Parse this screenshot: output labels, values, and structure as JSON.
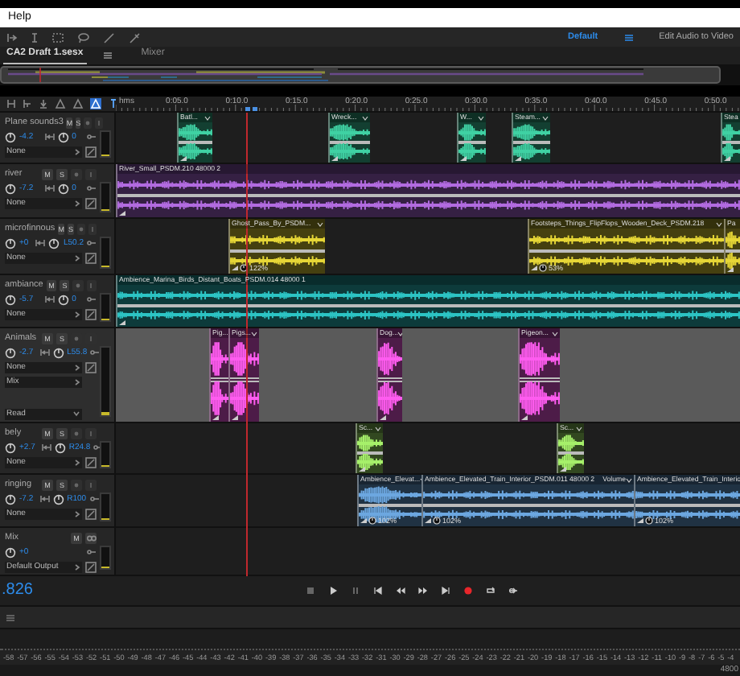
{
  "menu": [
    "Help"
  ],
  "workspaces": [
    {
      "label": "Default",
      "selected": true
    },
    {
      "label": "Edit Audio to Video",
      "selected": false
    }
  ],
  "tabs": [
    {
      "label": "CA2 Draft 1.sesx",
      "selected": true
    },
    {
      "label": "Mixer",
      "selected": false
    }
  ],
  "ruler_tools": [
    {
      "selected": false
    },
    {
      "selected": false
    },
    {
      "selected": true
    },
    {
      "selected": false
    }
  ],
  "ruler": {
    "labels": [
      "hms",
      "0:05.0",
      "0:10.0",
      "0:15.0",
      "0:20.0",
      "0:25.0",
      "0:30.0",
      "0:35.0",
      "0:40.0",
      "0:45.0",
      "0:50.0"
    ]
  },
  "tracks": [
    {
      "name": "Plane sounds3",
      "kind": "audio",
      "selected": false,
      "buttons": [
        "M",
        "S"
      ],
      "volume": "-4.2",
      "pan": "0",
      "level": 0.05,
      "dropdowns": [
        {
          "label": "None",
          "kind": "output"
        }
      ],
      "clips": [
        {
          "label": "Batl...",
          "color": "#3fd1a3"
        },
        {
          "label": "Wreck...",
          "color": "#3fd1a3"
        },
        {
          "label": "W...",
          "color": "#3fd1a3"
        },
        {
          "label": "Steam...",
          "color": "#3fd1a3"
        },
        {
          "label": "Stea",
          "color": "#3fd1a3"
        }
      ]
    },
    {
      "name": "river",
      "kind": "audio",
      "selected": false,
      "buttons": [
        "M",
        "S"
      ],
      "volume": "-7.2",
      "pan": "0",
      "level": 0.05,
      "dropdowns": [
        {
          "label": "None",
          "kind": "output"
        }
      ],
      "clips": [
        {
          "label": "River_Small_PSDM.210 48000 2",
          "color": "#b26be0"
        }
      ]
    },
    {
      "name": "microfinnous",
      "kind": "audio",
      "selected": false,
      "buttons": [
        "M",
        "S"
      ],
      "volume": "+0",
      "pan": "L50.2",
      "level": 0.05,
      "dropdowns": [
        {
          "label": "None",
          "kind": "output"
        }
      ],
      "clips": [
        {
          "label": "Ghost_Pass_By_PSDM...",
          "color": "#e6d636",
          "gain": "122%"
        },
        {
          "label": "Footsteps_Things_FlipFlops_Wooden_Deck_PSDM.218",
          "color": "#e6d636",
          "gain": "53%"
        },
        {
          "label": "Pa",
          "color": "#e6d636"
        }
      ]
    },
    {
      "name": "ambiance",
      "kind": "audio",
      "selected": false,
      "buttons": [
        "M",
        "S"
      ],
      "volume": "-5.7",
      "pan": "0",
      "level": 0.05,
      "dropdowns": [
        {
          "label": "None",
          "kind": "output"
        }
      ],
      "clips": [
        {
          "label": "Ambience_Marina_Birds_Distant_Boats_PSDM.014 48000 1",
          "color": "#2cc4c4"
        }
      ]
    },
    {
      "name": "Animals",
      "kind": "audio",
      "selected": true,
      "buttons": [
        "M",
        "S"
      ],
      "volume": "-2.7",
      "pan": "L55.8",
      "level": 0.05,
      "dropdowns": [
        {
          "label": "None",
          "kind": "output"
        },
        {
          "label": "Mix",
          "kind": "send"
        },
        {
          "label": "Read",
          "kind": "automation"
        }
      ],
      "clips": [
        {
          "label": "Pig...",
          "color": "#ff5cf0"
        },
        {
          "label": "Pigs...",
          "color": "#ff5cf0"
        },
        {
          "label": "Dog...",
          "color": "#ff5cf0"
        },
        {
          "label": "Pigeon...",
          "color": "#ff5cf0"
        }
      ]
    },
    {
      "name": "bely",
      "kind": "audio",
      "selected": false,
      "buttons": [
        "M",
        "S"
      ],
      "volume": "+2.7",
      "pan": "R24.8",
      "level": 0.05,
      "dropdowns": [
        {
          "label": "None",
          "kind": "output"
        }
      ],
      "clips": [
        {
          "label": "Sc...",
          "color": "#a6f06a"
        },
        {
          "label": "Sc...",
          "color": "#a6f06a"
        }
      ]
    },
    {
      "name": "ringing",
      "kind": "audio",
      "selected": false,
      "buttons": [
        "M",
        "S"
      ],
      "volume": "-7.2",
      "pan": "R100",
      "level": 0.05,
      "dropdowns": [
        {
          "label": "None",
          "kind": "output"
        }
      ],
      "clips": [
        {
          "label": "Ambience_Elevat...",
          "color": "#6ca7e0",
          "gain": "102%"
        },
        {
          "label": "Ambience_Elevated_Train_Interior_PSDM.011 48000 2",
          "color": "#6ca7e0",
          "gain": "102%",
          "envelope": "Volume"
        },
        {
          "label": "Ambience_Elevated_Train_Interio",
          "color": "#6ca7e0",
          "gain": "102%"
        }
      ]
    },
    {
      "name": "Mix",
      "kind": "master",
      "selected": false,
      "buttons": [
        "M"
      ],
      "volume": "+0",
      "level": 0.05,
      "dropdowns": [
        {
          "label": "Default Output",
          "kind": "output"
        }
      ]
    }
  ],
  "time": ".826",
  "meter_scale": [
    "-58",
    "-57",
    "-56",
    "-55",
    "-54",
    "-53",
    "-52",
    "-51",
    "-50",
    "-49",
    "-48",
    "-47",
    "-46",
    "-45",
    "-44",
    "-43",
    "-42",
    "-41",
    "-40",
    "-39",
    "-38",
    "-37",
    "-36",
    "-35",
    "-34",
    "-33",
    "-32",
    "-31",
    "-30",
    "-29",
    "-28",
    "-27",
    "-26",
    "-25",
    "-24",
    "-23",
    "-22",
    "-21",
    "-20",
    "-19",
    "-18",
    "-17",
    "-16",
    "-15",
    "-14",
    "-13",
    "-12",
    "-11",
    "-10",
    "-9",
    "-8",
    "-7",
    "-6",
    "-5",
    "-4"
  ],
  "status": "4800"
}
